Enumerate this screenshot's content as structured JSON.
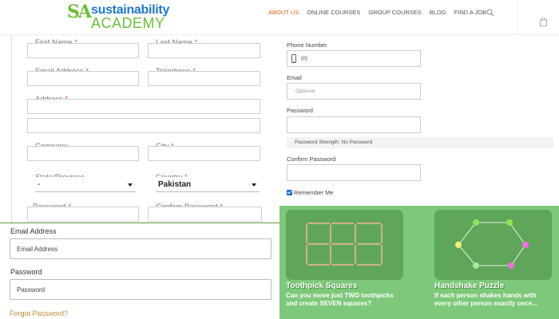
{
  "brand": {
    "logo_mark": "SA",
    "name_top": "sustainability",
    "name_bottom": "ACADEMY"
  },
  "nav": {
    "items": [
      "ABOUT US",
      "ONLINE COURSES",
      "GROUP COURSES",
      "BLOG",
      "FIND A JOB"
    ],
    "active": "ABOUT US"
  },
  "registration": {
    "first_name": "First Name",
    "last_name": "Last Name",
    "email": "Email Address",
    "telephone": "Telephone",
    "address": "Address",
    "company": "Company",
    "city": "City",
    "state": "State/Province",
    "state_value": "-",
    "country": "Country",
    "country_value": "Pakistan",
    "password": "Password",
    "confirm_password": "Confirm Password",
    "required_mark": "*"
  },
  "account_form": {
    "phone_label": "Phone Number",
    "phone_value": "(0)",
    "email_label": "Email",
    "email_placeholder": "Optional",
    "password_label": "Password",
    "strength_text": "Password Strength: No Password",
    "confirm_label": "Confirm Password",
    "remember_label": "Remember Me"
  },
  "login": {
    "email_label": "Email Address",
    "email_placeholder": "Email Address",
    "password_label": "Password",
    "password_placeholder": "Password",
    "forgot_link": "Forgot Password?"
  },
  "puzzles": [
    {
      "title": "Toothpick Squares",
      "description": "Can you move just TWO toothpicks and create SEVEN squares?"
    },
    {
      "title": "Handshake Puzzle",
      "description": "If each person shakes hands with every other person exactly once..."
    }
  ],
  "colors": {
    "accent": "#e8601c",
    "brand_blue": "#1f78c8",
    "brand_green": "#6cbf3a",
    "panel_green": "#7dc87a",
    "link": "#c28a3a"
  }
}
